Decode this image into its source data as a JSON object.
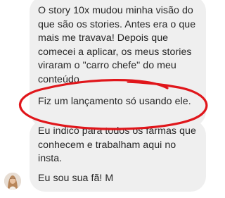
{
  "conversation": {
    "messages": [
      {
        "sender": "contact",
        "text": "O story 10x mudou minha visão do\nque são os stories. Antes era o que\nmais me travava! Depois que\ncomecei a aplicar, os meus stories\nviraram o \"carro chefe\" do meu\nconteúdo."
      },
      {
        "sender": "contact",
        "text": "Fiz um lançamento só usando ele."
      },
      {
        "sender": "contact",
        "text": "Eu indico para todos os farmas que\nconhecem e trabalham aqui no\ninsta."
      },
      {
        "sender": "contact",
        "text": "Eu sou sua fã! M"
      }
    ]
  },
  "colors": {
    "bubble": "#efefef",
    "text": "#262626",
    "annotation_mark": "#e0161b"
  },
  "icons": {
    "avatar": "contact-avatar"
  }
}
